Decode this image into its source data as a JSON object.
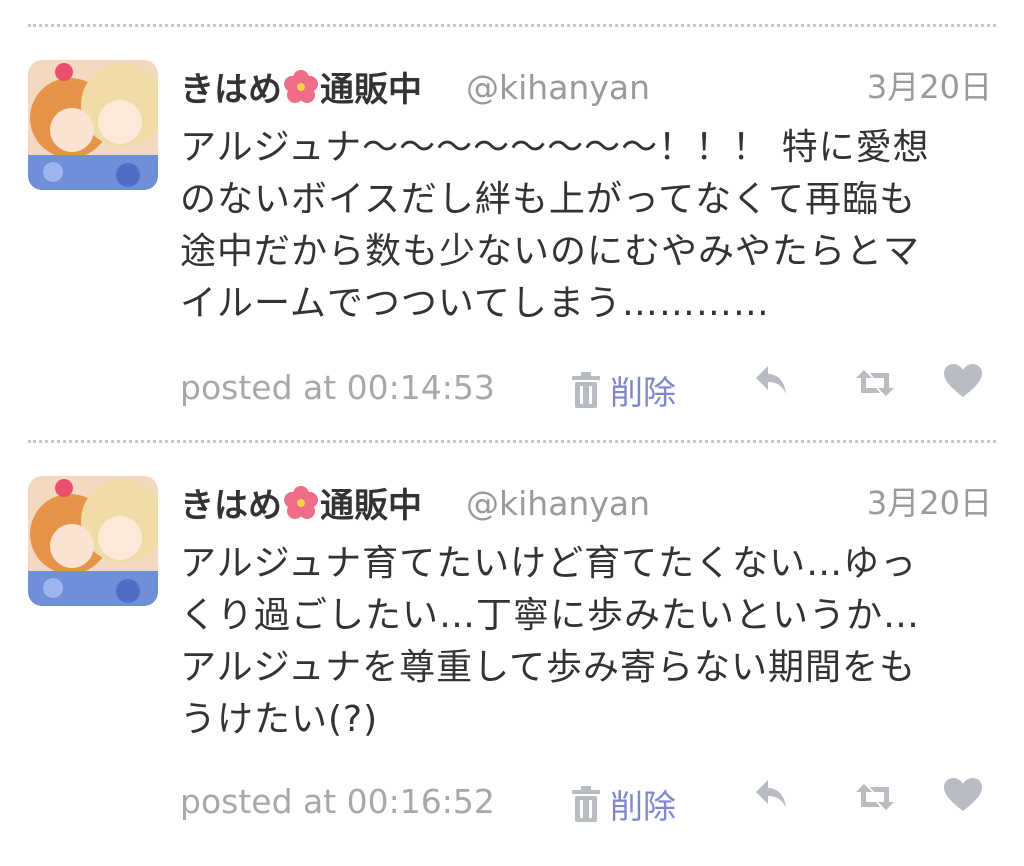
{
  "tweets": [
    {
      "display_name_a": "きはめ",
      "display_name_b": "通販中",
      "handle": "@kihanyan",
      "date": "3月20日",
      "lines": [
        "アルジュナ〜〜〜〜〜〜〜〜！！！ 特に愛想",
        "のないボイスだし絆も上がってなくて再臨も",
        "途中だから数も少ないのにむやみやたらとマ",
        "イルームでつついてしまう…………"
      ],
      "posted": "posted at 00:14:53",
      "delete_label": "削除"
    },
    {
      "display_name_a": "きはめ",
      "display_name_b": "通販中",
      "handle": "@kihanyan",
      "date": "3月20日",
      "lines": [
        "アルジュナ育てたいけど育てたくない…ゆっ",
        "くり過ごしたい…丁寧に歩みたいというか…",
        "アルジュナを尊重して歩み寄らない期間をも",
        "うけたい(?)"
      ],
      "posted": "posted at 00:16:52",
      "delete_label": "削除"
    }
  ],
  "icons": {
    "flower": "hibiscus-icon",
    "trash": "trash-icon",
    "reply": "reply-icon",
    "retweet": "retweet-icon",
    "like": "heart-icon"
  },
  "colors": {
    "text": "#333333",
    "muted": "#9a9a9a",
    "link": "#7f86cc",
    "icon": "#b9bcc2",
    "flower": "#e8506e"
  }
}
